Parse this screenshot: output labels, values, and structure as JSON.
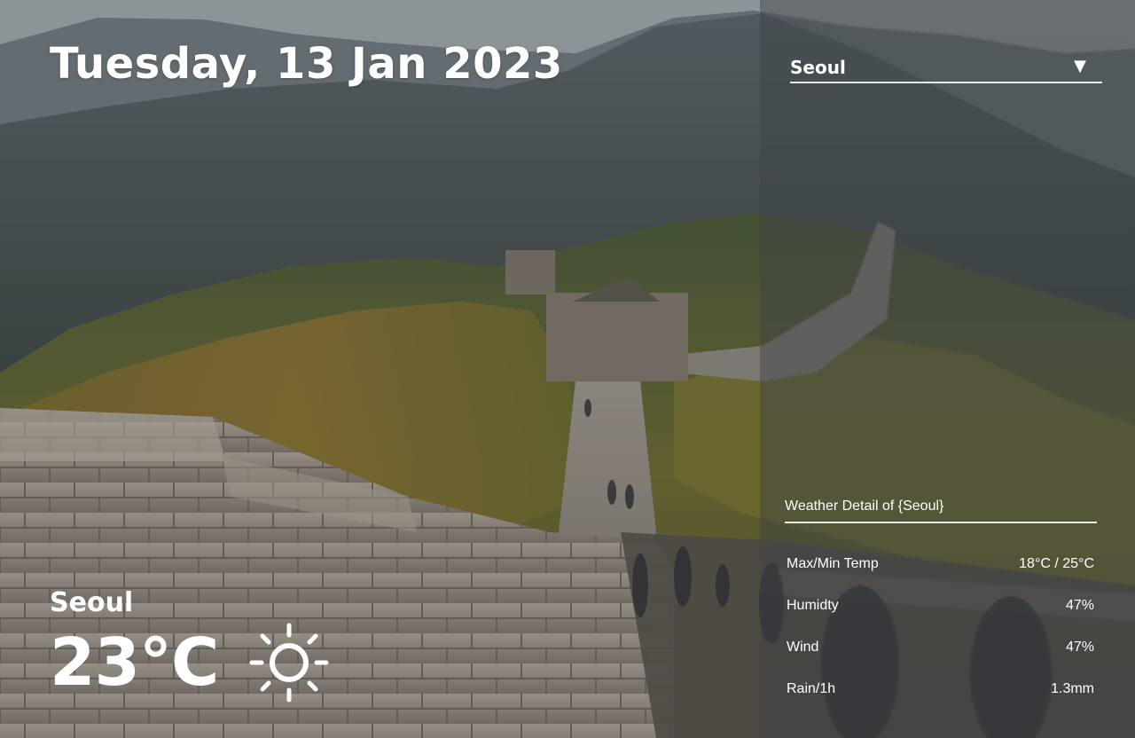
{
  "header": {
    "date": "Tuesday, 13 Jan 2023"
  },
  "current": {
    "city": "Seoul",
    "temperature": "23°C",
    "condition_icon": "sun-icon"
  },
  "city_select": {
    "selected": "Seoul",
    "caret": "▼"
  },
  "detail": {
    "heading": "Weather Detail of {Seoul}",
    "rows": [
      {
        "label": "Max/Min Temp",
        "value": "18°C / 25°C"
      },
      {
        "label": "Humidty",
        "value": "47%"
      },
      {
        "label": "Wind",
        "value": "47%"
      },
      {
        "label": "Rain/1h",
        "value": "1.3mm"
      }
    ]
  },
  "colors": {
    "text": "#ffffff",
    "panel_overlay": "#3c4246",
    "divider": "#e8e8e8"
  }
}
